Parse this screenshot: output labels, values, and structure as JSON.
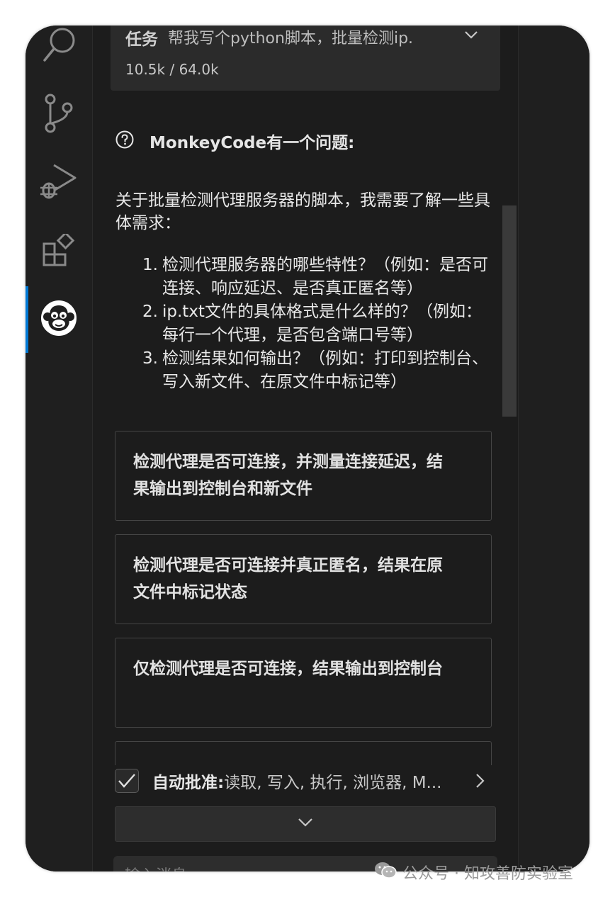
{
  "activity_bar": {
    "items": [
      {
        "icon": "search-icon"
      },
      {
        "icon": "source-control-icon"
      },
      {
        "icon": "run-debug-icon"
      },
      {
        "icon": "extensions-icon"
      },
      {
        "icon": "monkey-icon"
      }
    ],
    "active_color": "#0078d4"
  },
  "task": {
    "label": "任务",
    "text": "帮我写个python脚本，批量检测ip.",
    "tokens": "10.5k / 64.0k"
  },
  "question": {
    "title": "MonkeyCode有一个问题:",
    "intro": "关于批量检测代理服务器的脚本，我需要了解一些具体需求：",
    "items": [
      {
        "num": "1.",
        "text": "检测代理服务器的哪些特性？（例如：是否可连接、响应延迟、是否真正匿名等）"
      },
      {
        "num": "2.",
        "text": "ip.txt文件的具体格式是什么样的？（例如：每行一个代理，是否包含端口号等）"
      },
      {
        "num": "3.",
        "text": "检测结果如何输出？（例如：打印到控制台、写入新文件、在原文件中标记等）"
      }
    ]
  },
  "options": [
    {
      "text": "检测代理是否可连接，并测量连接延迟，结果输出到控制台和新文件"
    },
    {
      "text": "检测代理是否可连接并真正匿名，结果在原文件中标记状态"
    },
    {
      "text": "仅检测代理是否可连接，结果输出到控制台"
    }
  ],
  "auto_approve": {
    "label": "自动批准:",
    "detail": " 读取, 写入, 执行, 浏览器, M...",
    "checked": true
  },
  "input": {
    "placeholder": "输入消息..."
  },
  "watermark": {
    "text": "公众号 · 知攻善防实验室"
  }
}
